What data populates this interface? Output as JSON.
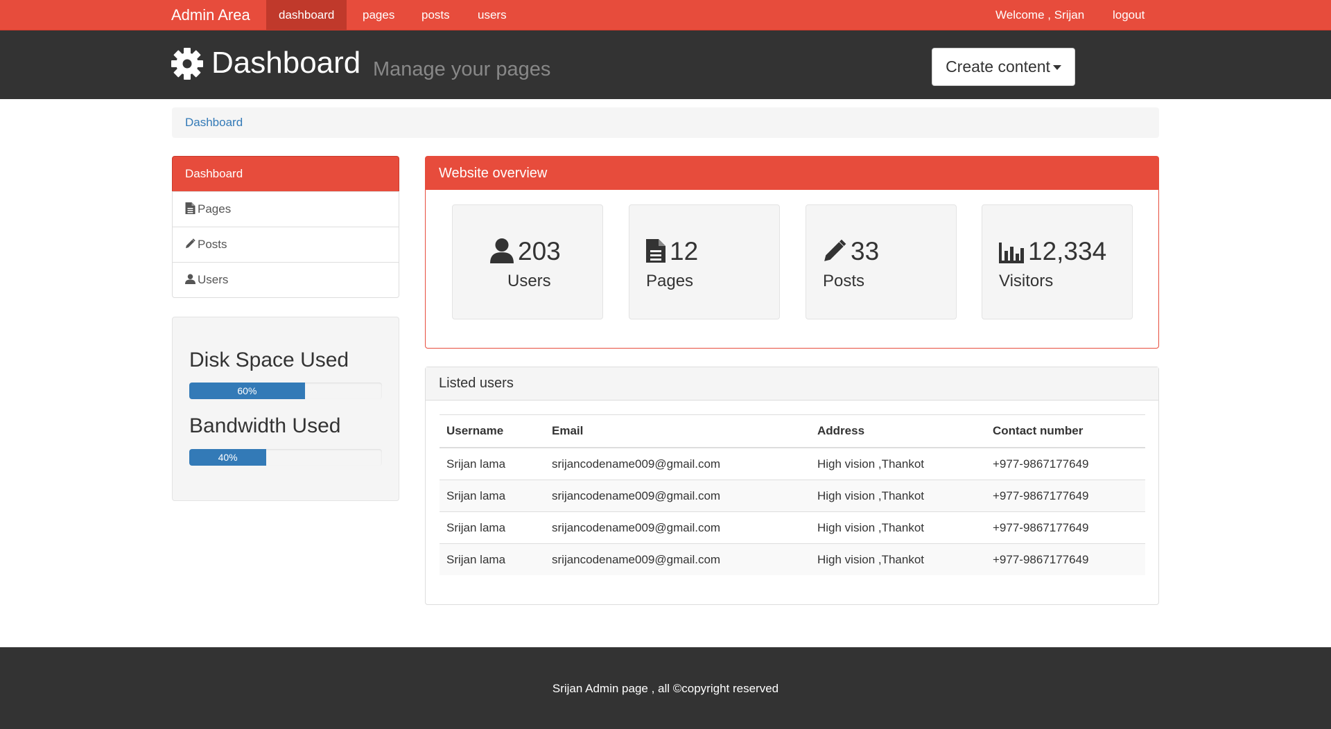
{
  "navbar": {
    "brand": "Admin Area",
    "links": [
      "dashboard",
      "pages",
      "posts",
      "users"
    ],
    "welcome": "Welcome , Srijan",
    "logout": "logout"
  },
  "header": {
    "title": "Dashboard",
    "subtitle": "Manage your pages",
    "create_button": "Create content"
  },
  "breadcrumb": "Dashboard",
  "sidebar": {
    "items": [
      {
        "label": "Dashboard",
        "icon": ""
      },
      {
        "label": "Pages",
        "icon": "file-icon"
      },
      {
        "label": "Posts",
        "icon": "pencil-icon"
      },
      {
        "label": "Users",
        "icon": "user-icon"
      }
    ]
  },
  "usage": {
    "disk_label": "Disk Space Used",
    "disk_value": 60,
    "disk_text": "60%",
    "bandwidth_label": "Bandwidth Used",
    "bandwidth_value": 40,
    "bandwidth_text": "40%"
  },
  "overview": {
    "title": "Website overview",
    "stats": [
      {
        "value": "203",
        "label": "Users",
        "icon": "user-icon"
      },
      {
        "value": "12",
        "label": "Pages",
        "icon": "file-icon"
      },
      {
        "value": "33",
        "label": "Posts",
        "icon": "pencil-icon"
      },
      {
        "value": "12,334",
        "label": "Visitors",
        "icon": "stats-icon"
      }
    ]
  },
  "users_panel": {
    "title": "Listed users",
    "columns": [
      "Username",
      "Email",
      "Address",
      "Contact number"
    ],
    "rows": [
      [
        "Srijan lama",
        "srijancodename009@gmail.com",
        "High vision ,Thankot",
        "+977-9867177649"
      ],
      [
        "Srijan lama",
        "srijancodename009@gmail.com",
        "High vision ,Thankot",
        "+977-9867177649"
      ],
      [
        "Srijan lama",
        "srijancodename009@gmail.com",
        "High vision ,Thankot",
        "+977-9867177649"
      ],
      [
        "Srijan lama",
        "srijancodename009@gmail.com",
        "High vision ,Thankot",
        "+977-9867177649"
      ]
    ]
  },
  "footer": "Srijan Admin page , all ©copyright reserved",
  "colors": {
    "accent": "#e74c3c",
    "dark": "#333333",
    "bar": "#337ab7"
  }
}
